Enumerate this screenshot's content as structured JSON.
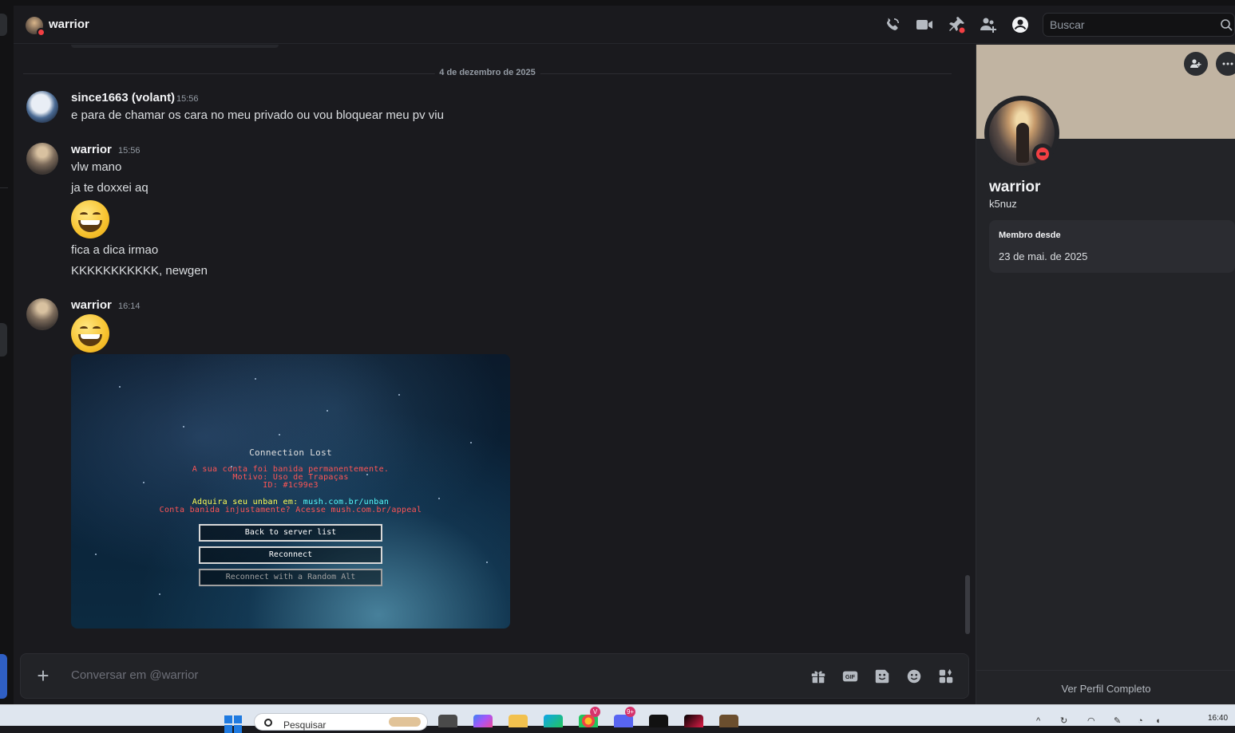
{
  "header": {
    "title": "warrior",
    "search_placeholder": "Buscar"
  },
  "chat": {
    "date_divider": "4 de dezembro de 2025",
    "messages": [
      {
        "author": "since1663 (volant)",
        "time": "15:56",
        "lines": [
          "e para de chamar os cara no meu privado ou vou bloquear meu pv viu"
        ]
      },
      {
        "author": "warrior",
        "time": "15:56",
        "lines": [
          "vlw mano",
          "ja te doxxei aq",
          "fica a dica irmao",
          "KKKKKKKKKKK, newgen"
        ]
      },
      {
        "author": "warrior",
        "time": "16:14"
      }
    ],
    "screenshot": {
      "title": "Connection Lost",
      "ban_line1": "A sua conta foi banida permanentemente.",
      "ban_line2": "Motivo: Uso de Trapaças",
      "ban_line3": "ID: #1c99e3",
      "unban_prefix": "Adquira seu unban em: ",
      "unban_url": "mush.com.br/unban",
      "appeal_line": "Conta banida injustamente? Acesse mush.com.br/appeal",
      "buttons": [
        "Back to server list",
        "Reconnect",
        "Reconnect with a Random Alt"
      ]
    }
  },
  "composer": {
    "placeholder": "Conversar em @warrior"
  },
  "profile": {
    "display_name": "warrior",
    "username": "k5nuz",
    "member_since_label": "Membro desde",
    "member_since_value": "23 de mai. de 2025",
    "view_full_profile": "Ver Perfil Completo"
  },
  "taskbar": {
    "search_placeholder": "Pesquisar",
    "clock": "16:40",
    "discord_badge": "9+",
    "browser_badge": "V"
  },
  "colors": {
    "background": "#1a1a1e",
    "dnd_status": "#f23f43",
    "profile_banner": "#c1b4a2",
    "accent_blue": "#2f5fc4"
  },
  "icons": [
    "voice-call-icon",
    "video-call-icon",
    "pin-icon",
    "add-friend-icon",
    "user-profile-icon",
    "search-icon",
    "gift-icon",
    "gif-icon",
    "sticker-icon",
    "emoji-icon",
    "apps-icon"
  ]
}
